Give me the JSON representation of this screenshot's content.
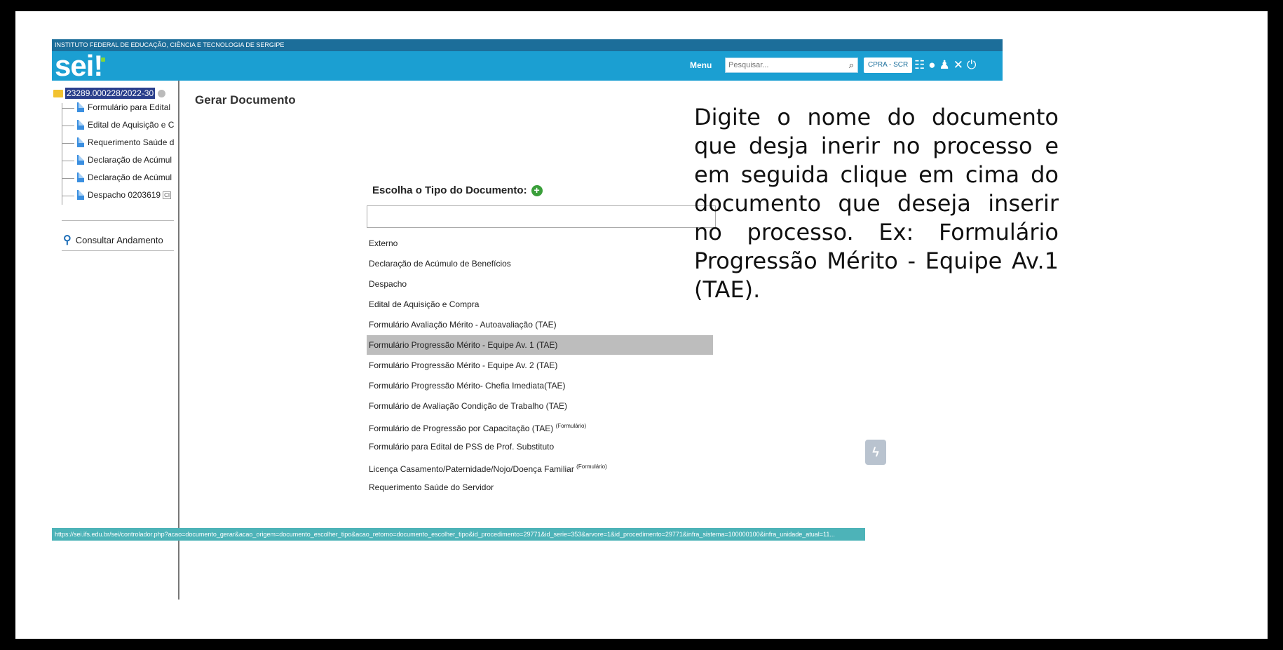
{
  "header": {
    "institution": "INSTITUTO FEDERAL DE EDUCAÇÃO, CIÊNCIA E TECNOLOGIA DE SERGIPE",
    "logo_text": "sei",
    "menu_label": "Menu",
    "search_placeholder": "Pesquisar...",
    "unit_label": "CPRA - SCR",
    "icons": [
      "list-icon",
      "info-icon",
      "user-icon",
      "tools-icon",
      "power-icon"
    ]
  },
  "sidebar": {
    "process_number": "23289.000228/2022-30",
    "documents": [
      {
        "label": "Formulário para Edital"
      },
      {
        "label": "Edital de Aquisição e C"
      },
      {
        "label": "Requerimento Saúde d"
      },
      {
        "label": "Declaração de Acúmul"
      },
      {
        "label": "Declaração de Acúmul"
      },
      {
        "label": "Despacho 0203619",
        "tag": "CI"
      }
    ],
    "consult_label": "Consultar Andamento"
  },
  "main": {
    "title": "Gerar Documento",
    "choose_label": "Escolha o Tipo do Documento:",
    "type_input_value": "",
    "options": [
      {
        "label": "Externo",
        "sup": "",
        "selected": false
      },
      {
        "label": "Declaração de Acúmulo de Benefícios",
        "sup": "",
        "selected": false
      },
      {
        "label": "Despacho",
        "sup": "",
        "selected": false
      },
      {
        "label": "Edital de Aquisição e Compra",
        "sup": "",
        "selected": false
      },
      {
        "label": "Formulário Avaliação Mérito - Autoavaliação (TAE)",
        "sup": "",
        "selected": false
      },
      {
        "label": "Formulário Progressão Mérito - Equipe Av. 1 (TAE)",
        "sup": "",
        "selected": true
      },
      {
        "label": "Formulário Progressão Mérito - Equipe Av. 2 (TAE)",
        "sup": "",
        "selected": false
      },
      {
        "label": "Formulário Progressão Mérito- Chefia Imediata(TAE)",
        "sup": "",
        "selected": false
      },
      {
        "label": "Formulário de Avaliação Condição de Trabalho (TAE)",
        "sup": "",
        "selected": false
      },
      {
        "label": "Formulário de Progressão por Capacitação (TAE)",
        "sup": "(Formulário)",
        "selected": false
      },
      {
        "label": "Formulário para Edital de PSS de Prof. Substituto",
        "sup": "",
        "selected": false
      },
      {
        "label": "Licença Casamento/Paternidade/Nojo/Doença Familiar",
        "sup": "(Formulário)",
        "selected": false
      },
      {
        "label": "Requerimento Saúde do Servidor",
        "sup": "",
        "selected": false
      }
    ]
  },
  "status_url": "https://sei.ifs.edu.br/sei/controlador.php?acao=documento_gerar&acao_origem=documento_escolher_tipo&acao_retorno=documento_escolher_tipo&id_procedimento=29771&id_serie=353&arvore=1&id_procedimento=29771&infra_sistema=100000100&infra_unidade_atual=11...",
  "annotation": "Digite o nome do documento que desja inerir no processo e em seguida clique em cima do documento que deseja inserir no processo. Ex: Formulário Progressão Mérito - Equipe Av.1 (TAE).",
  "colors": {
    "topbar": "#1b9fd2",
    "instbar": "#1c6e9a",
    "selected_row": "#bdbdbd",
    "statusbar": "#4db3b8"
  }
}
